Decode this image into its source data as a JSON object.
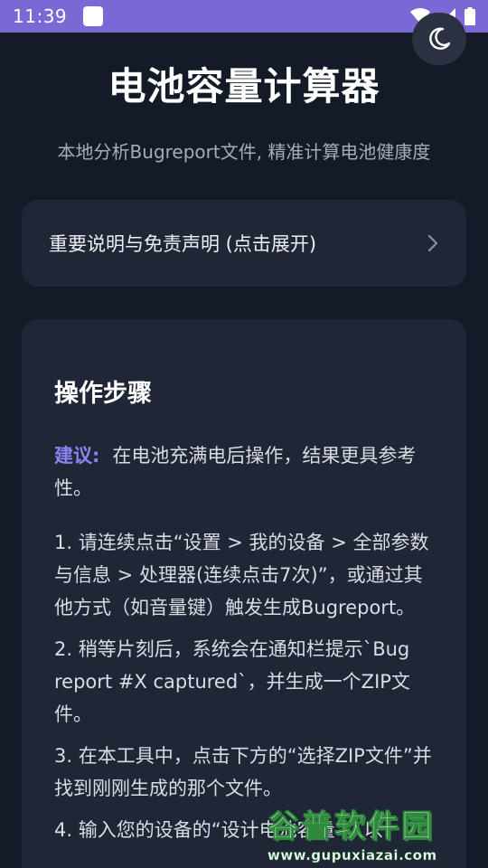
{
  "status_bar": {
    "time": "11:39",
    "icons": [
      "notification-icon",
      "wifi-icon",
      "signal-icon",
      "battery-icon"
    ]
  },
  "header": {
    "title": "电池容量计算器",
    "subtitle": "本地分析Bugreport文件, 精准计算电池健康度",
    "theme_toggle_icon": "moon-icon"
  },
  "disclaimer": {
    "label": "重要说明与免责声明 (点击展开)",
    "icon": "chevron-right-icon"
  },
  "steps_card": {
    "title": "操作步骤",
    "suggestion_label": "建议:",
    "suggestion_text": "在电池充满电后操作，结果更具参考性。",
    "steps": [
      "1. 请连续点击“设置 > 我的设备 > 全部参数与信息 > 处理器(连续点击7次)”，或通过其他方式（如音量键）触发生成Bugreport。",
      "2. 稍等片刻后，系统会在通知栏提示`Bug report #X captured`，并生成一个ZIP文件。",
      "3. 在本工具中，点击下方的“选择ZIP文件”并找到刚刚生成的那个文件。",
      "4. 输入您的设备的“设计电池容量”，以"
    ]
  },
  "watermark": {
    "main": "谷普软件园",
    "url": "www.gupuxiazai.com"
  },
  "colors": {
    "status_bar": "#7b68d4",
    "background": "#131a28",
    "card": "#1f2635",
    "accent": "#8c84f0",
    "watermark_green": "#2f8a3c"
  }
}
